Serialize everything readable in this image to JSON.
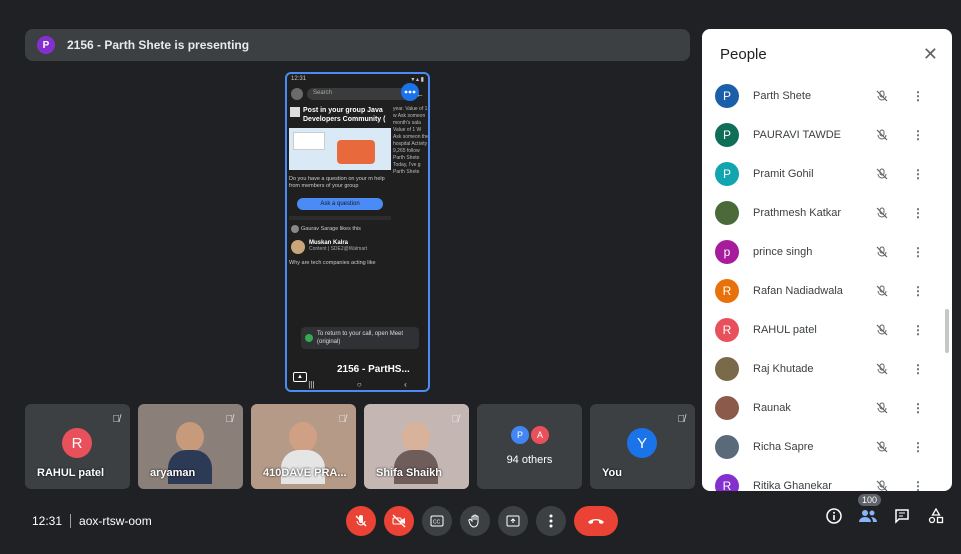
{
  "presenting": {
    "avatar_letter": "P",
    "text": "2156 - Parth Shete is presenting",
    "avatar_color": "#8430ce"
  },
  "phone": {
    "status_time": "12:31",
    "search_placeholder": "Search",
    "post_title": "Post in your group Java Developers Community (",
    "post_body": "Do you have a question on your m help from members of your group",
    "ask_button": "Ask a question",
    "side_text": "year. Value of 1 w Ask someon month's sala Value of 1 W Ask someon the hospital Activity 9,265 follow Parth Shete Today, I've g Parth Shete",
    "like_line": "Gaurav Sarage likes this",
    "author": "Muskan Kalra",
    "author_meta": "Content | SDE2@Walmart",
    "why_text": "Why are tech companies acting like",
    "toast": "To return to your call, open Meet (original)",
    "overlay_name": "2156 - PartHS..."
  },
  "tiles": [
    {
      "name": "RAHUL patel",
      "avatar": "R",
      "avatar_color": "#e8505b",
      "type": "avatar"
    },
    {
      "name": "aryaman",
      "type": "video",
      "bg": "#8a7f79",
      "skin": "#c89a7c",
      "shirt": "#2d3a55"
    },
    {
      "name": "410DAVE PRA...",
      "type": "video",
      "bg": "#b59a87",
      "skin": "#d0a084",
      "shirt": "#e5e5e5"
    },
    {
      "name": "Shifa Shaikh",
      "type": "video",
      "bg": "#c4b6b2",
      "skin": "#d9b29b",
      "shirt": "#6e5d5a"
    },
    {
      "name": "94 others",
      "type": "others",
      "av1": "P",
      "av1_color": "#4285f4",
      "av2": "A",
      "av2_color": "#e8505b"
    },
    {
      "name": "You",
      "avatar": "Y",
      "avatar_color": "#1a73e8",
      "type": "avatar"
    }
  ],
  "people_panel": {
    "title": "People",
    "participants": [
      {
        "name": "Parth Shete",
        "letter": "P",
        "color": "#1a5fa8"
      },
      {
        "name": "PAURAVI TAWDE",
        "letter": "P",
        "color": "#0f6e57"
      },
      {
        "name": "Pramit Gohil",
        "letter": "P",
        "color": "#12a4af"
      },
      {
        "name": "Prathmesh Katkar",
        "letter": "",
        "color": "#4a6a3a"
      },
      {
        "name": "prince singh",
        "letter": "p",
        "color": "#a61c9c"
      },
      {
        "name": "Rafan Nadiadwala",
        "letter": "R",
        "color": "#e8710a"
      },
      {
        "name": "RAHUL patel",
        "letter": "R",
        "color": "#e8505b"
      },
      {
        "name": "Raj Khutade",
        "letter": "",
        "color": "#7a6a4a"
      },
      {
        "name": "Raunak",
        "letter": "",
        "color": "#8b5a4a"
      },
      {
        "name": "Richa Sapre",
        "letter": "",
        "color": "#5a6a7a"
      },
      {
        "name": "Ritika Ghanekar",
        "letter": "R",
        "color": "#8430ce"
      }
    ]
  },
  "bottom": {
    "time": "12:31",
    "meeting_code": "aox-rtsw-oom",
    "people_count": "100"
  }
}
